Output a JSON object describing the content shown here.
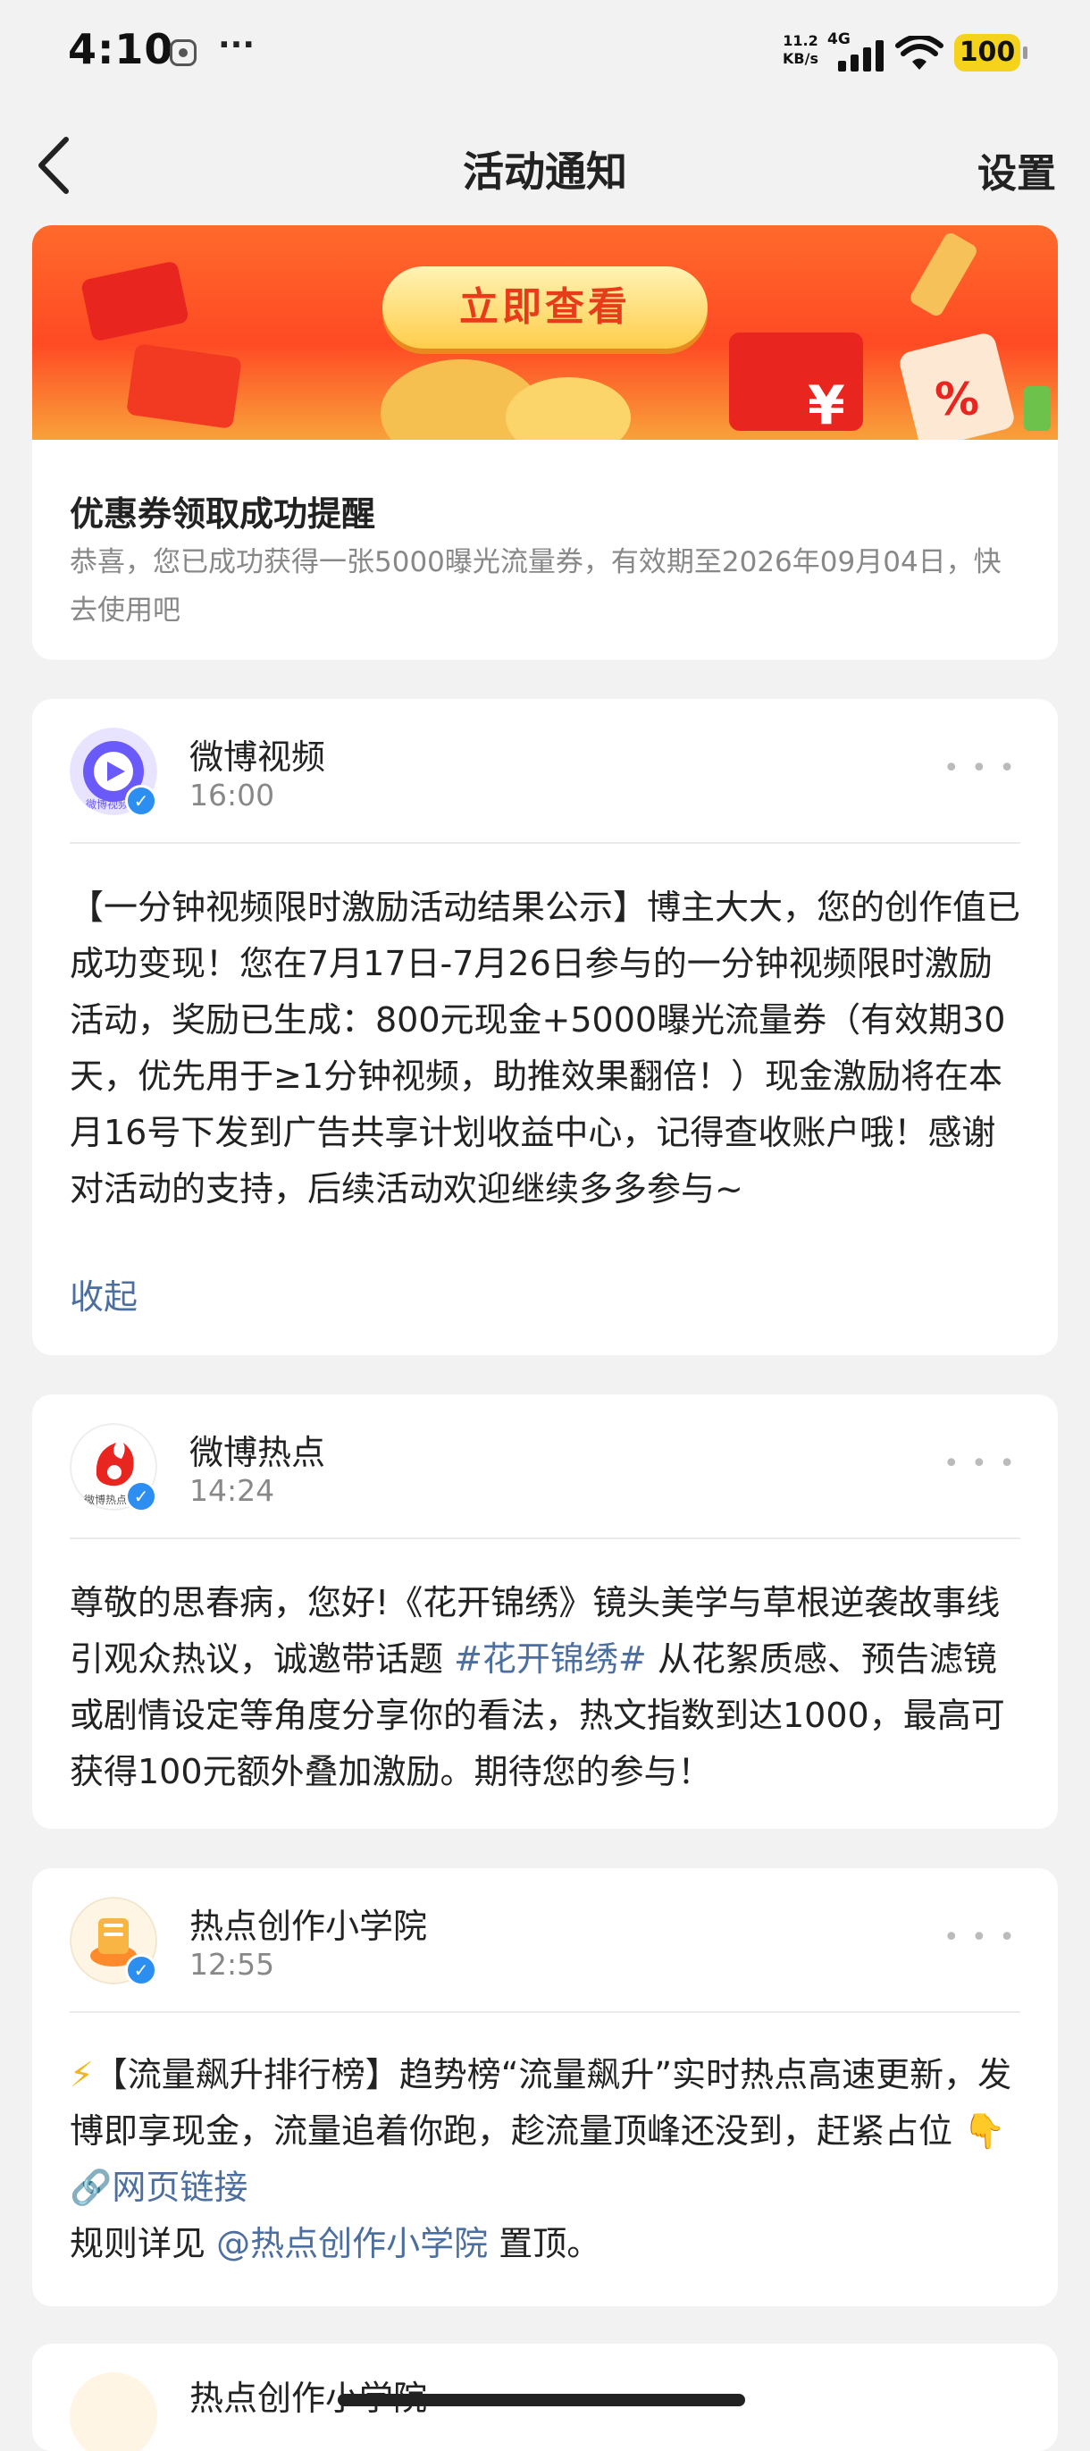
{
  "status_bar": {
    "time": "4:10",
    "more": "···",
    "speed_top": "11.2",
    "speed_bottom": "KB/s",
    "network": "4G",
    "battery": "100",
    "battery_color": "#f5d21b"
  },
  "nav": {
    "title": "活动通知",
    "settings": "设置"
  },
  "coupon_card": {
    "banner_button": "立即查看",
    "title": "优惠券领取成功提醒",
    "body": "恭喜，您已成功获得一张5000曝光流量券，有效期至2026年09月04日，快去使用吧"
  },
  "posts": [
    {
      "name": "微博视频",
      "time": "16:00",
      "body": "【一分钟视频限时激励活动结果公示】博主大大，您的创作值已成功变现！您在7月17日-7月26日参与的一分钟视频限时激励活动，奖励已生成：800元现金+5000曝光流量券（有效期30天，优先用于≥1分钟视频，助推效果翻倍！）现金激励将在本月16号下发到广告共享计划收益中心，记得查收账户哦！感谢对活动的支持，后续活动欢迎继续多多参与~",
      "collapse": "收起",
      "avatar_label": "微博视频"
    },
    {
      "name": "微博热点",
      "time": "14:24",
      "body_before": "尊敬的思春病，您好!《花开锦绣》镜头美学与草根逆袭故事线引观众热议，诚邀带话题 ",
      "hashtag": "#花开锦绣#",
      "body_after": " 从花絮质感、预告滤镜或剧情设定等角度分享你的看法，热文指数到达1000，最高可获得100元额外叠加激励。期待您的参与！",
      "avatar_label": "微博热点"
    },
    {
      "name": "热点创作小学院",
      "time": "12:55",
      "bolt": "⚡",
      "body_before": "【流量飙升排行榜】趋势榜“流量飙升”实时热点高速更新，发博即享现金，流量追着你跑，趁流量顶峰还没到，赶紧占位 ",
      "pointer": "👇",
      "link_icon": "🔗",
      "link_text": "网页链接",
      "rules_before": "规则详见 ",
      "mention": "@热点创作小学院",
      "rules_after": " 置顶。"
    }
  ],
  "next_card_name": "热点创作小学院",
  "colors": {
    "accent_link": "#4d6fa0",
    "verified": "#2b8ef0",
    "banner": "#ff4a24"
  }
}
